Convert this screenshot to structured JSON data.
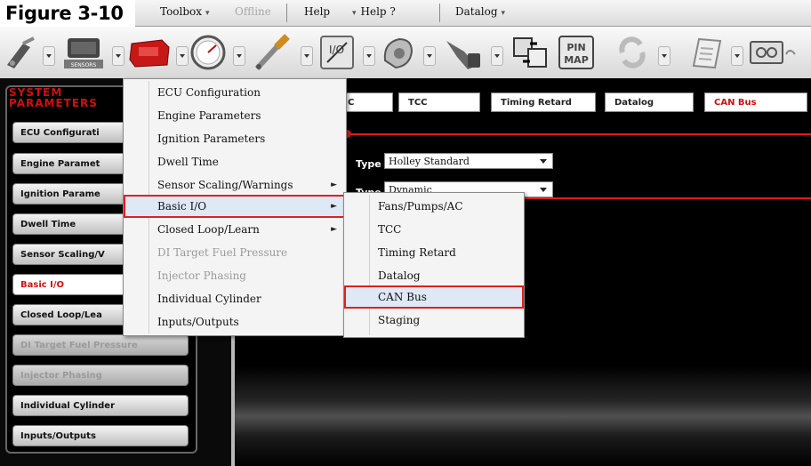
{
  "figure": {
    "label": "Figure 3-10"
  },
  "menubar": {
    "items": [
      {
        "label": "Toolbox",
        "arrow": "▾"
      },
      {
        "label": "Offline",
        "arrow": ""
      },
      {
        "label": "Help",
        "arrow": ""
      },
      {
        "label": "Help ?",
        "arrow": "▾"
      },
      {
        "label": "Datalog",
        "arrow": "▾"
      }
    ],
    "help_prefix": "▾"
  },
  "toolbar": {
    "icons": [
      "injector-wiring-icon",
      "ecu-module-icon",
      "ecu-red-icon",
      "gauge-icon",
      "fuel-injector-icon",
      "io-switch-icon",
      "ignition-coil-icon",
      "throttle-pedal-icon",
      "transfer-icon",
      "pin-map-icon",
      "refresh-icon",
      "notepad-icon",
      "datalog-icon"
    ],
    "sensors_label": "SENSORS",
    "io_label": "I/O",
    "pin_map_label": "PIN\nMAP"
  },
  "sidebar": {
    "title_line1": "SYSTEM",
    "title_line2": "PARAMETERS",
    "items": [
      {
        "label": "ECU Configurati",
        "state": "normal"
      },
      {
        "label": "Engine Paramet",
        "state": "normal"
      },
      {
        "label": "Ignition Parame",
        "state": "normal"
      },
      {
        "label": "Dwell Time",
        "state": "normal"
      },
      {
        "label": "Sensor Scaling/V",
        "state": "normal"
      },
      {
        "label": "Basic I/O",
        "state": "active"
      },
      {
        "label": "Closed Loop/Lea",
        "state": "normal"
      },
      {
        "label": "DI Target Fuel Pressure",
        "state": "disabled"
      },
      {
        "label": "Injector Phasing",
        "state": "disabled"
      },
      {
        "label": "Individual Cylinder",
        "state": "normal"
      },
      {
        "label": "Inputs/Outputs",
        "state": "normal"
      }
    ]
  },
  "tabs": [
    {
      "label": "C",
      "active": false
    },
    {
      "label": "TCC",
      "active": false
    },
    {
      "label": "Timing Retard",
      "active": false
    },
    {
      "label": "Datalog",
      "active": false
    },
    {
      "label": "CAN Bus",
      "active": true
    }
  ],
  "form": {
    "type_label": "Type",
    "type_value": "Holley Standard",
    "type2_label": "Type",
    "type2_value": "Dynamic"
  },
  "context_menu": {
    "items": [
      {
        "label": "ECU Configuration",
        "submenu": false,
        "disabled": false
      },
      {
        "label": "Engine Parameters",
        "submenu": false,
        "disabled": false
      },
      {
        "label": "Ignition Parameters",
        "submenu": false,
        "disabled": false
      },
      {
        "label": "Dwell Time",
        "submenu": false,
        "disabled": false
      },
      {
        "label": "Sensor Scaling/Warnings",
        "submenu": true,
        "disabled": false
      },
      {
        "label": "Basic I/O",
        "submenu": true,
        "disabled": false,
        "highlighted": true
      },
      {
        "label": "Closed Loop/Learn",
        "submenu": true,
        "disabled": false
      },
      {
        "label": "DI Target Fuel Pressure",
        "submenu": false,
        "disabled": true
      },
      {
        "label": "Injector Phasing",
        "submenu": false,
        "disabled": true
      },
      {
        "label": "Individual Cylinder",
        "submenu": false,
        "disabled": false
      },
      {
        "label": "Inputs/Outputs",
        "submenu": false,
        "disabled": false
      }
    ],
    "submenu_glyph": "►"
  },
  "submenu": {
    "items": [
      {
        "label": "Fans/Pumps/AC"
      },
      {
        "label": "TCC"
      },
      {
        "label": "Timing Retard"
      },
      {
        "label": "Datalog"
      },
      {
        "label": "CAN Bus",
        "highlighted": true
      },
      {
        "label": "Staging"
      }
    ]
  },
  "colors": {
    "accent_red": "#e01c1c",
    "highlight_bg": "#dfe8f5"
  }
}
